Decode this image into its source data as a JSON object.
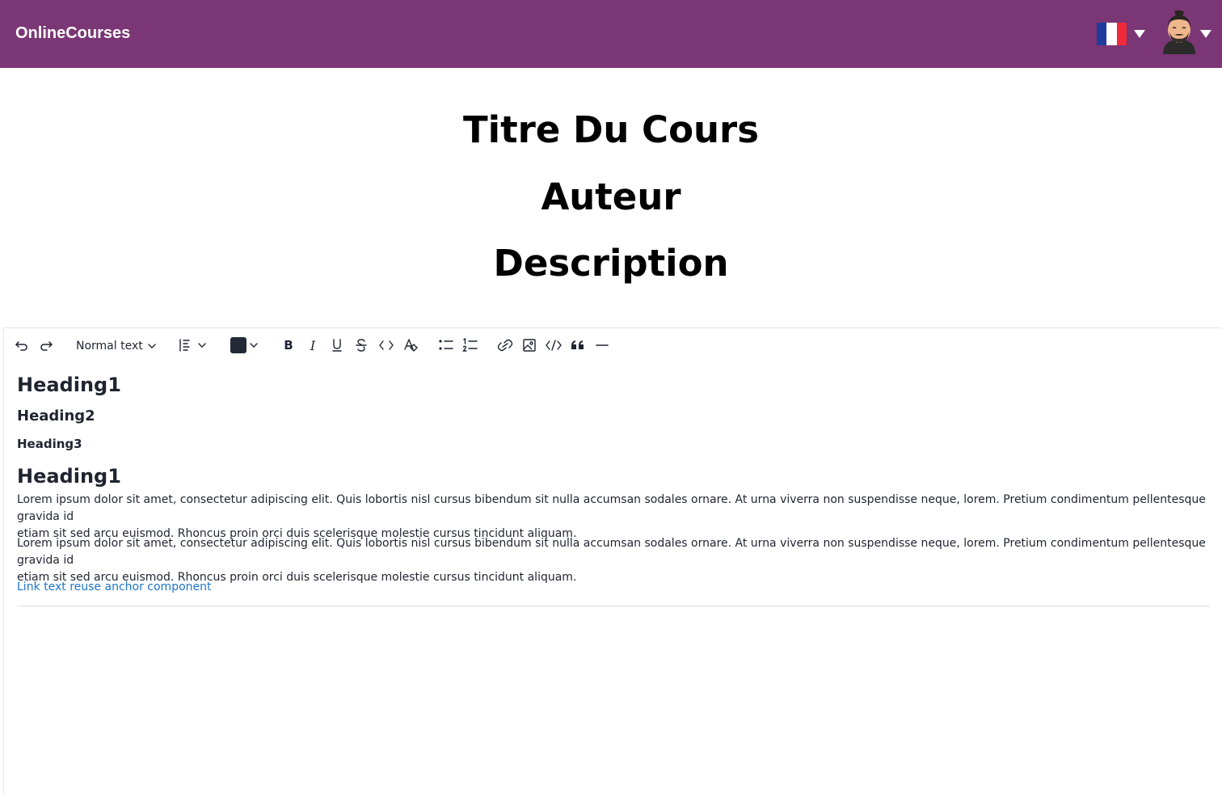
{
  "navbar": {
    "brand": "OnlineCourses",
    "language_flag": "france-flag-icon",
    "colors": {
      "background": "#7a3675",
      "text": "#ffffff"
    }
  },
  "hero": {
    "title": "Titre Du Cours",
    "author": "Auteur",
    "description": "Description"
  },
  "toolbar": {
    "block_style": "Normal text",
    "text_color": "#232a36",
    "icons": [
      "undo-icon",
      "redo-icon",
      "align-icon",
      "bold-icon",
      "italic-icon",
      "underline-icon",
      "strikethrough-icon",
      "inline-code-icon",
      "clear-format-icon",
      "bullet-list-icon",
      "numbered-list-icon",
      "link-icon",
      "image-icon",
      "code-block-icon",
      "quote-icon",
      "horizontal-rule-icon"
    ]
  },
  "editor": {
    "heading1_a": "Heading1",
    "heading2": "Heading2",
    "heading3": "Heading3",
    "heading1_b": "Heading1",
    "paragraph1_line1": "Lorem ipsum dolor sit amet, consectetur adipiscing elit. Quis lobortis nisl cursus bibendum sit nulla accumsan sodales ornare. At urna viverra non suspendisse neque, lorem. Pretium condimentum pellentesque gravida id",
    "paragraph1_line2": "etiam sit sed arcu euismod. Rhoncus proin orci duis scelerisque molestie cursus tincidunt aliquam.",
    "paragraph2_line1": "Lorem ipsum dolor sit amet, consectetur adipiscing elit. Quis lobortis nisl cursus bibendum sit nulla accumsan sodales ornare. At urna viverra non suspendisse neque, lorem. Pretium condimentum pellentesque gravida id",
    "paragraph2_line2": "etiam sit sed arcu euismod. Rhoncus proin orci duis scelerisque molestie cursus tincidunt aliquam.",
    "link_text": "Link text reuse anchor component",
    "link_color": "#1b74c9"
  }
}
